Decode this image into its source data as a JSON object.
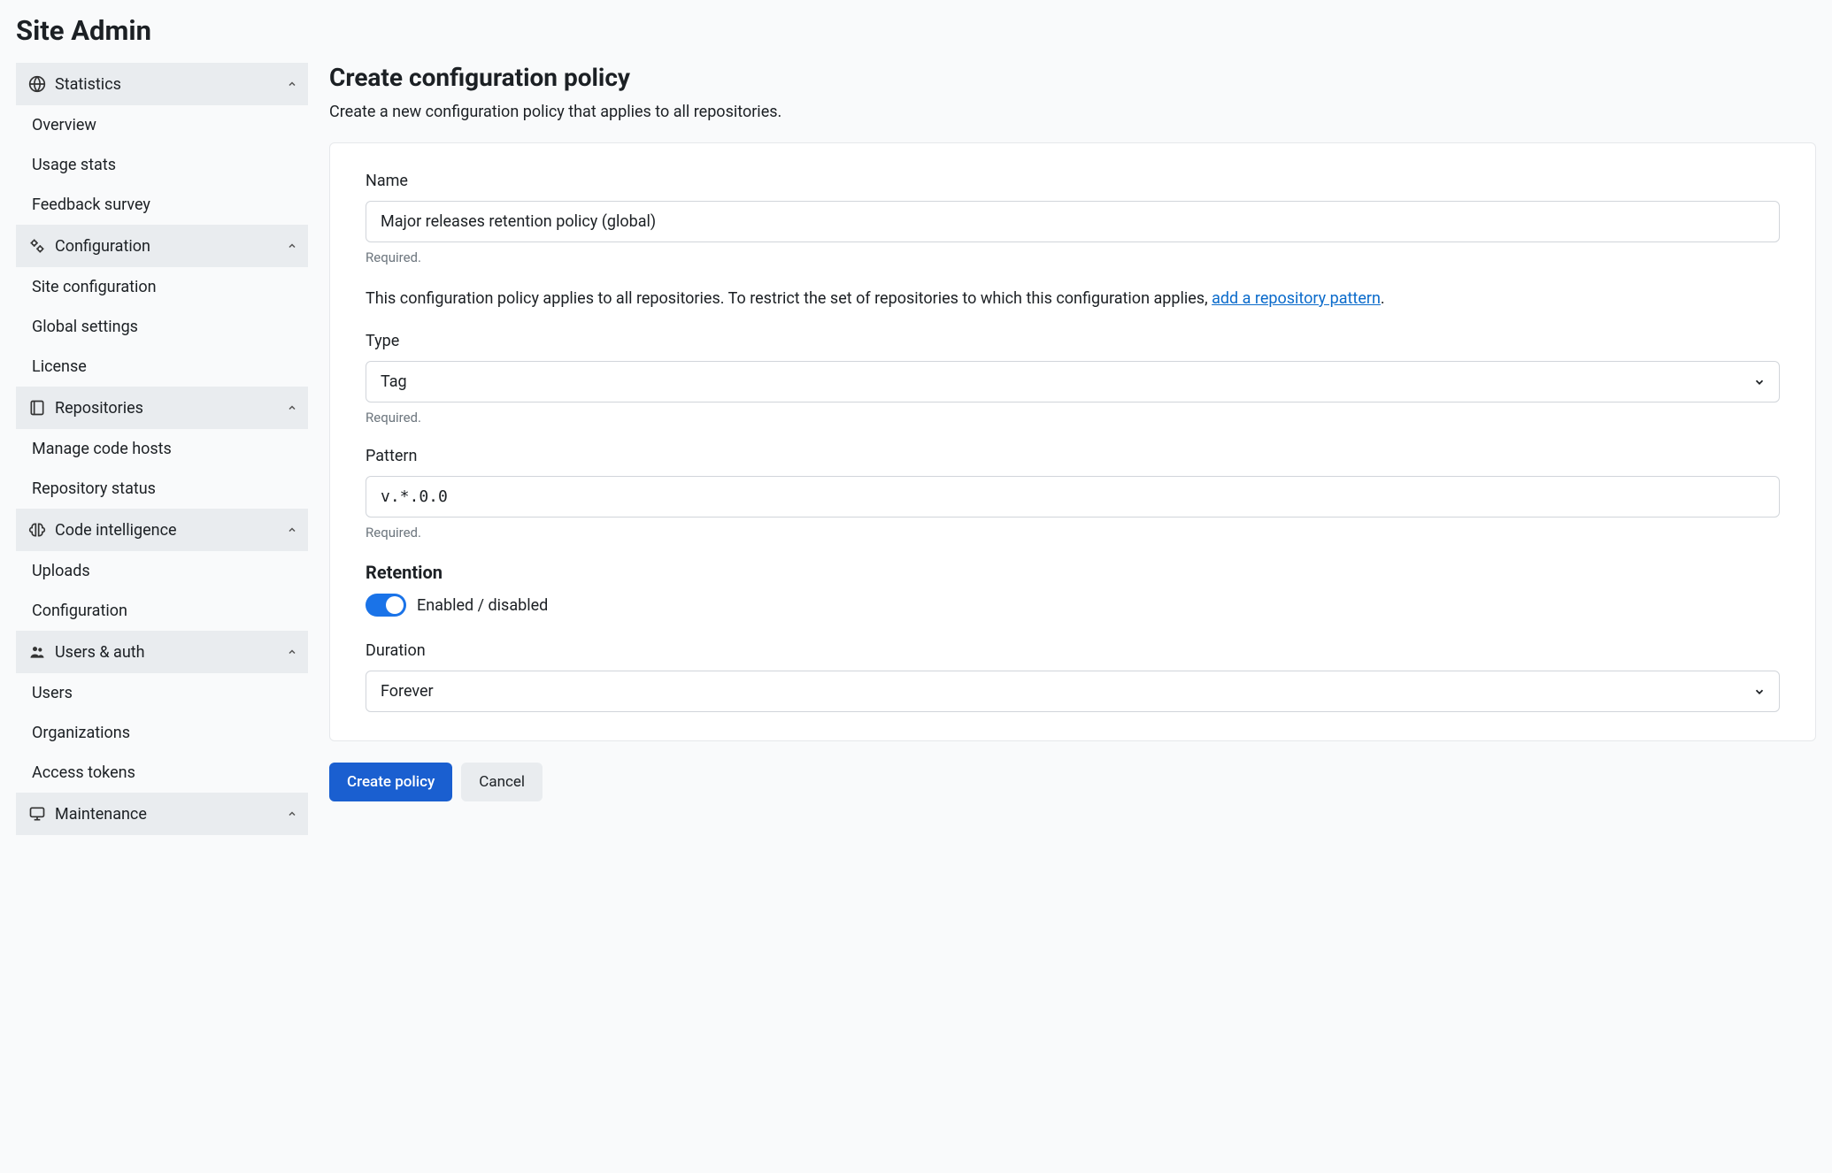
{
  "page_title": "Site Admin",
  "sidebar": {
    "sections": [
      {
        "label": "Statistics",
        "icon": "globe",
        "items": [
          "Overview",
          "Usage stats",
          "Feedback survey"
        ]
      },
      {
        "label": "Configuration",
        "icon": "gears",
        "items": [
          "Site configuration",
          "Global settings",
          "License"
        ]
      },
      {
        "label": "Repositories",
        "icon": "repo",
        "items": [
          "Manage code hosts",
          "Repository status"
        ]
      },
      {
        "label": "Code intelligence",
        "icon": "brain",
        "items": [
          "Uploads",
          "Configuration"
        ]
      },
      {
        "label": "Users & auth",
        "icon": "users",
        "items": [
          "Users",
          "Organizations",
          "Access tokens"
        ]
      },
      {
        "label": "Maintenance",
        "icon": "monitor",
        "items": []
      }
    ]
  },
  "main": {
    "heading": "Create configuration policy",
    "subtitle": "Create a new configuration policy that applies to all repositories.",
    "form": {
      "name_label": "Name",
      "name_value": "Major releases retention policy (global)",
      "required_text": "Required.",
      "desc_prefix": "This configuration policy applies to all repositories. To restrict the set of repositories to which this configuration applies, ",
      "desc_link": "add a repository pattern",
      "desc_suffix": ".",
      "type_label": "Type",
      "type_value": "Tag",
      "pattern_label": "Pattern",
      "pattern_value": "v.*.0.0",
      "retention_heading": "Retention",
      "retention_toggle_label": "Enabled / disabled",
      "retention_enabled": true,
      "duration_label": "Duration",
      "duration_value": "Forever"
    },
    "actions": {
      "primary": "Create policy",
      "secondary": "Cancel"
    }
  }
}
